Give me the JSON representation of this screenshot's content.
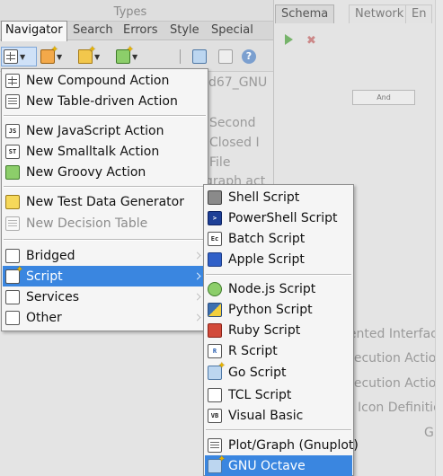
{
  "background": {
    "types_label": "Types",
    "right_tabs": [
      "Schema",
      "Network",
      "En"
    ],
    "action_button": "And",
    "fragments": {
      "title_fragment": "d67_GNU",
      "second": "Second",
      "closed": "Closed I",
      "file": "File",
      "graph": "graph act",
      "iented": "iented Interface",
      "exec1": "xecution Action",
      "exec2": "xecution Action",
      "icon_def": "Icon Definition",
      "gu": "GU"
    }
  },
  "navigator": {
    "tabs": [
      "Navigator",
      "Search",
      "Errors",
      "Style",
      "Special"
    ],
    "active_tab": "Navigator"
  },
  "main_menu": {
    "items": [
      {
        "label": "New Compound Action",
        "icon": "compound-action-icon"
      },
      {
        "label": "New Table-driven Action",
        "icon": "table-action-icon"
      },
      {
        "label": "New JavaScript Action",
        "icon": "javascript-icon"
      },
      {
        "label": "New Smalltalk Action",
        "icon": "smalltalk-icon"
      },
      {
        "label": "New Groovy Action",
        "icon": "groovy-icon"
      },
      {
        "label": "New Test Data Generator",
        "icon": "test-data-icon"
      },
      {
        "label": "New Decision Table",
        "icon": "decision-table-icon",
        "disabled": true
      },
      {
        "label": "Bridged",
        "icon": "bridged-folder-icon",
        "submenu": true
      },
      {
        "label": "Script",
        "icon": "script-folder-icon",
        "submenu": true,
        "highlighted": true
      },
      {
        "label": "Services",
        "icon": "services-folder-icon",
        "submenu": true
      },
      {
        "label": "Other",
        "icon": "other-folder-icon",
        "submenu": true
      }
    ]
  },
  "script_submenu": {
    "items": [
      {
        "label": "Shell Script",
        "icon": "shell-script-icon"
      },
      {
        "label": "PowerShell Script",
        "icon": "powershell-icon"
      },
      {
        "label": "Batch Script",
        "icon": "batch-script-icon"
      },
      {
        "label": "Apple Script",
        "icon": "apple-script-icon"
      },
      {
        "label": "Node.js Script",
        "icon": "nodejs-icon"
      },
      {
        "label": "Python Script",
        "icon": "python-icon"
      },
      {
        "label": "Ruby Script",
        "icon": "ruby-icon"
      },
      {
        "label": "R Script",
        "icon": "r-script-icon"
      },
      {
        "label": "Go Script",
        "icon": "go-script-icon"
      },
      {
        "label": "TCL Script",
        "icon": "tcl-script-icon"
      },
      {
        "label": "Visual Basic",
        "icon": "visual-basic-icon"
      },
      {
        "label": "Plot/Graph (Gnuplot)",
        "icon": "gnuplot-icon"
      },
      {
        "label": "GNU Octave",
        "icon": "gnu-octave-icon",
        "highlighted": true
      }
    ]
  },
  "icon_text": {
    "javascript": "JS",
    "smalltalk": "ST",
    "batch": "Ec",
    "r": "R",
    "vb": "VB"
  },
  "colors": {
    "highlight": "#3a86e0",
    "menu_bg": "#f5f5f5",
    "selected_tool": "#cfe1f7"
  }
}
